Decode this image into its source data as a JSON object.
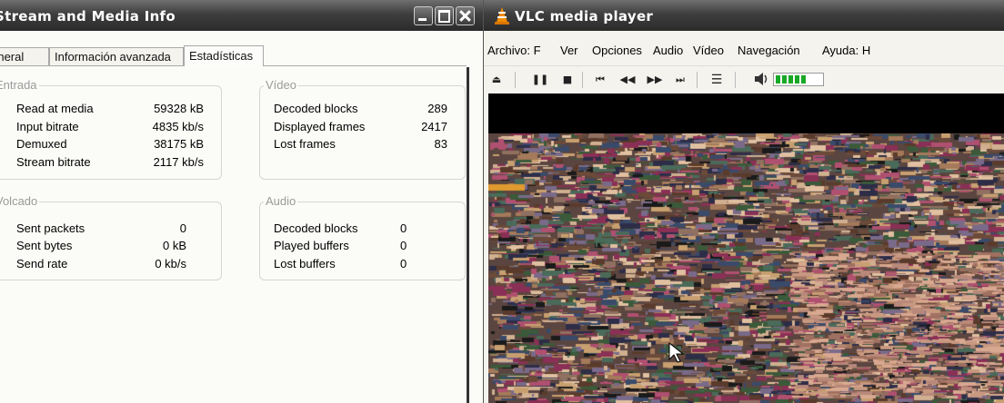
{
  "info_window": {
    "title": "Stream and Media Info",
    "tabs": [
      {
        "label": "General"
      },
      {
        "label": "Información avanzada"
      },
      {
        "label": "Estadísticas",
        "active": true
      }
    ],
    "groups": {
      "input": {
        "title": "Entrada",
        "rows": [
          {
            "label": "Read at media",
            "value": "59328 kB"
          },
          {
            "label": "Input bitrate",
            "value": "4835 kb/s"
          },
          {
            "label": "Demuxed",
            "value": "38175 kB"
          },
          {
            "label": "Stream bitrate",
            "value": "2117 kb/s"
          }
        ]
      },
      "video": {
        "title": "Vídeo",
        "rows": [
          {
            "label": "Decoded blocks",
            "value": "289"
          },
          {
            "label": "Displayed frames",
            "value": "2417"
          },
          {
            "label": "Lost frames",
            "value": "83"
          }
        ]
      },
      "output": {
        "title": "Volcado",
        "rows": [
          {
            "label": "Sent packets",
            "value": "0"
          },
          {
            "label": "Sent bytes",
            "value": "0 kB"
          },
          {
            "label": "Send rate",
            "value": "0 kb/s"
          }
        ]
      },
      "audio": {
        "title": "Audio",
        "rows": [
          {
            "label": "Decoded blocks",
            "value": "0"
          },
          {
            "label": "Played buffers",
            "value": "0"
          },
          {
            "label": "Lost buffers",
            "value": "0"
          }
        ]
      }
    }
  },
  "vlc_window": {
    "title": "VLC media player",
    "menu": [
      "Archivo: F",
      "Ver",
      "Opciones",
      "Audio",
      "Vídeo",
      "Navegación",
      "Ayuda: H"
    ],
    "toolbar_icons": [
      "eject-icon",
      "pause-icon",
      "stop-icon",
      "skip-back-icon",
      "rewind-icon",
      "fast-forward-icon",
      "skip-forward-icon",
      "playlist-icon",
      "speaker-icon"
    ],
    "volume_level": 0.55,
    "volume_color": "#19a825"
  },
  "colors": {
    "titlebar": "#3e3e3e",
    "window_bg": "#f4f3ee",
    "group_title": "#9a9a9a"
  }
}
